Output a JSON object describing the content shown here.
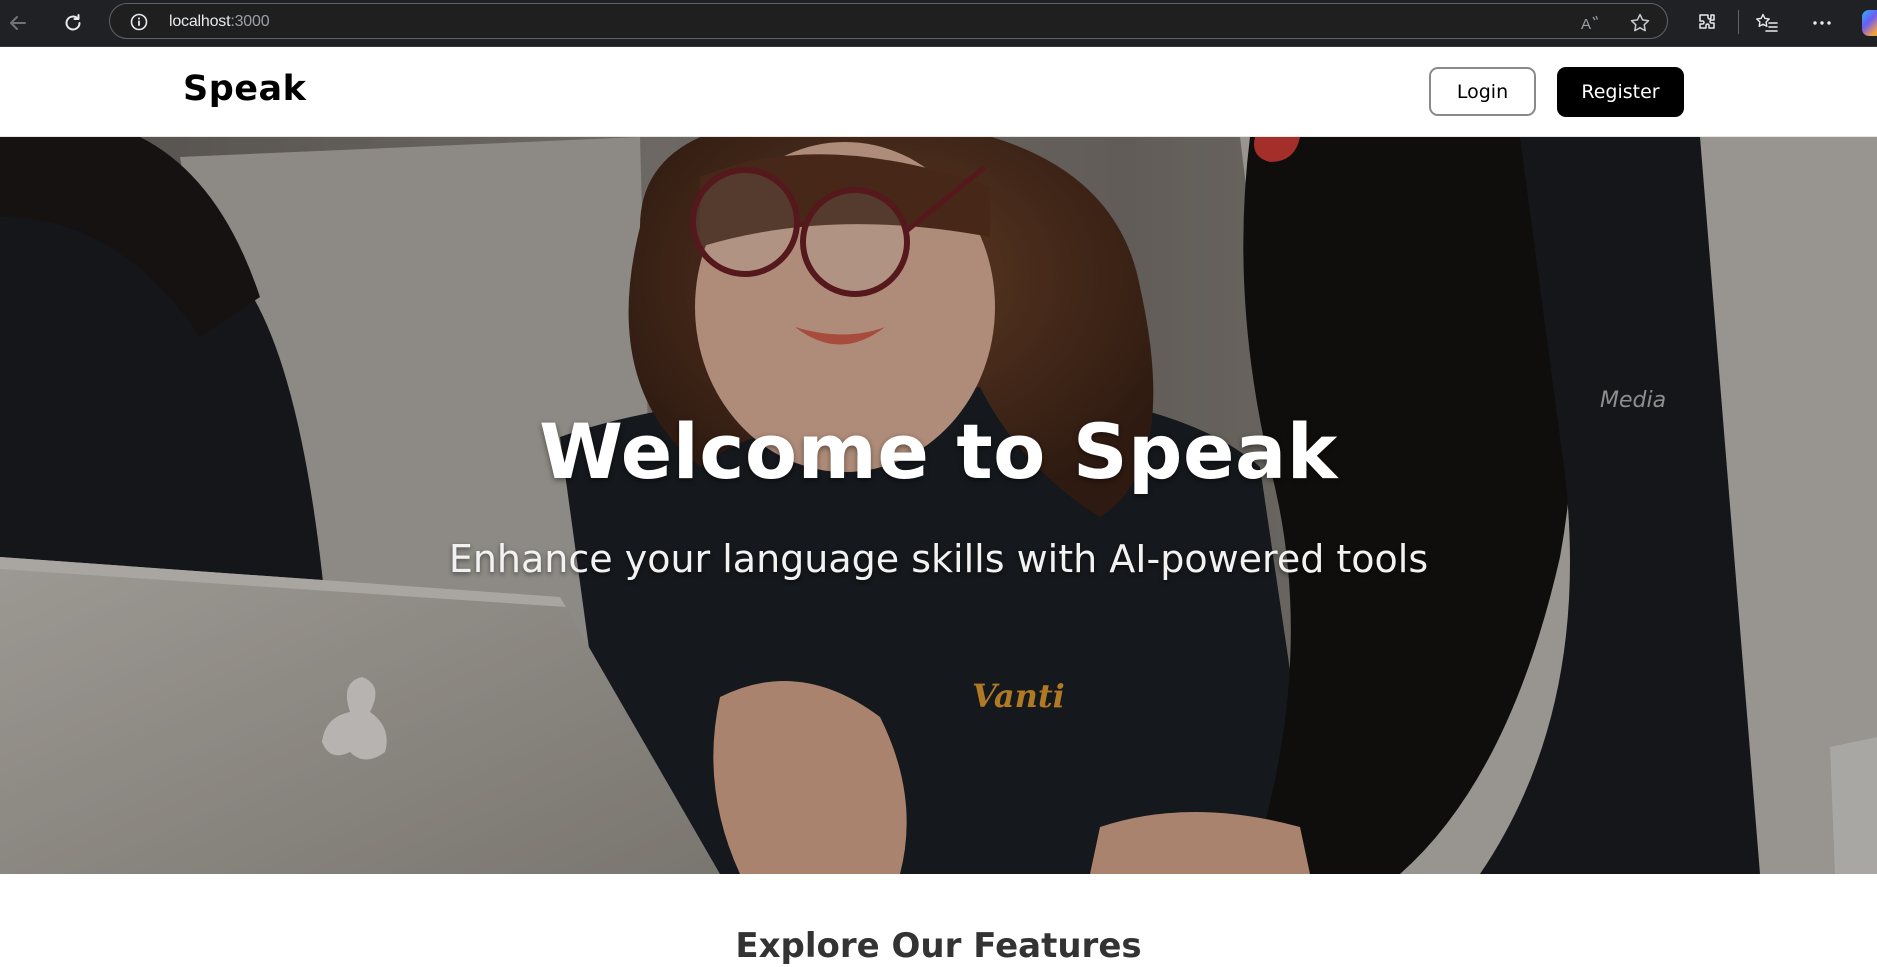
{
  "browser": {
    "url_host": "localhost",
    "url_port": ":3000",
    "icons": [
      "back-icon",
      "reload-icon",
      "info-icon",
      "read-aloud-icon",
      "favorite-star-icon",
      "extensions-icon",
      "favorites-icon",
      "more-icon",
      "copilot-icon"
    ]
  },
  "header": {
    "brand": "Speak",
    "login_label": "Login",
    "register_label": "Register"
  },
  "hero": {
    "title": "Welcome to Speak",
    "subtitle": "Enhance your language skills with AI-powered tools"
  },
  "features": {
    "title": "Explore Our Features"
  },
  "colors": {
    "header_bg": "#ffffff",
    "register_bg": "#000000",
    "hero_text": "#ffffff",
    "features_title": "#333333"
  }
}
